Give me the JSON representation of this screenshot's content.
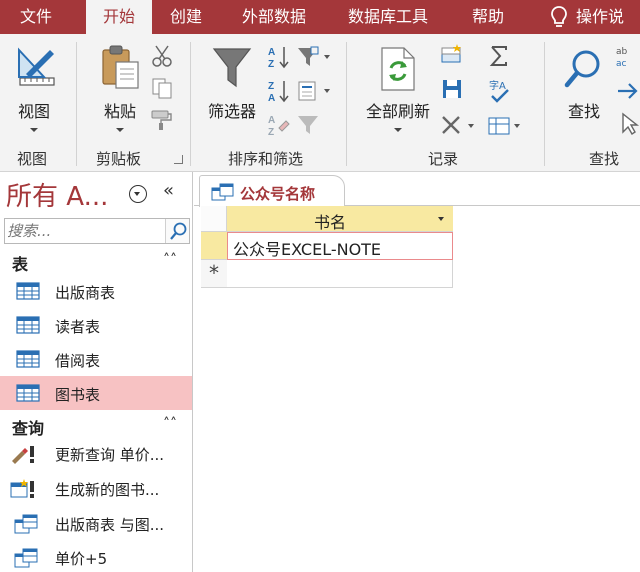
{
  "tabs": [
    "文件",
    "开始",
    "创建",
    "外部数据",
    "数据库工具",
    "帮助"
  ],
  "tell_me": "操作说",
  "ribbon": {
    "view_button": "视图",
    "paste_button": "粘贴",
    "filter_button": "筛选器",
    "refresh_button": "全部刷新",
    "find_button": "查找",
    "groups": [
      "视图",
      "剪贴板",
      "排序和筛选",
      "记录",
      "查找"
    ]
  },
  "nav": {
    "title": "所有 A...",
    "collapse_glyph": "«",
    "search_placeholder": "搜索...",
    "sections": [
      {
        "label": "表",
        "chevron": "˄˄",
        "items": [
          {
            "label": "出版商表",
            "icon": "table-icon",
            "selected": false
          },
          {
            "label": "读者表",
            "icon": "table-icon",
            "selected": false
          },
          {
            "label": "借阅表",
            "icon": "table-icon",
            "selected": false
          },
          {
            "label": "图书表",
            "icon": "table-icon",
            "selected": true
          }
        ]
      },
      {
        "label": "查询",
        "chevron": "˄˄",
        "items": [
          {
            "label": "更新查询 单价...",
            "icon": "update-query-icon"
          },
          {
            "label": "生成新的图书...",
            "icon": "make-table-query-icon"
          },
          {
            "label": "出版商表 与图...",
            "icon": "select-query-icon"
          },
          {
            "label": "单价+5",
            "icon": "select-query-icon"
          }
        ]
      }
    ]
  },
  "document": {
    "tab_label": "公众号名称",
    "column_header": "书名",
    "rows": [
      "公众号EXCEL-NOTE"
    ],
    "new_record_marker": "*"
  },
  "colors": {
    "accent": "#a4373a",
    "header_fill": "#f8e9a1",
    "selected_item": "#f7c2c3"
  }
}
